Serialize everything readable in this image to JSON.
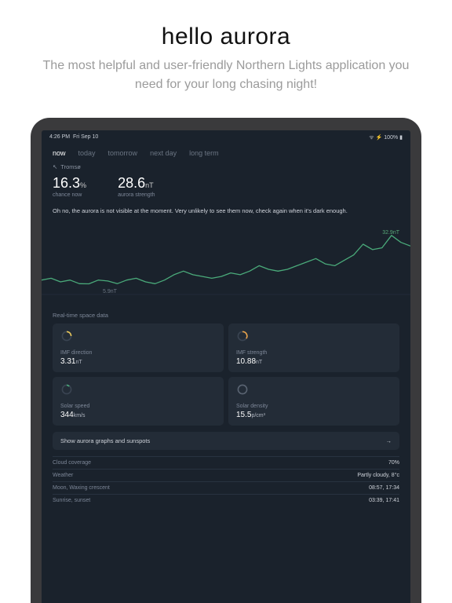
{
  "marketing": {
    "title": "hello aurora",
    "subtitle": "The most helpful and user-friendly Northern Lights application you need for your long chasing night!"
  },
  "statusbar": {
    "time": "4:26 PM",
    "date": "Fri Sep 10",
    "battery": "100%"
  },
  "tabs": [
    "now",
    "today",
    "tomorrow",
    "next day",
    "long term"
  ],
  "active_tab": "now",
  "location": "Tromsø",
  "metrics": {
    "chance": {
      "value": "16.3",
      "unit": "%",
      "label": "chance now"
    },
    "strength": {
      "value": "28.6",
      "unit": "nT",
      "label": "aurora strength"
    }
  },
  "message": "Oh no, the aurora is not visible at the moment. Very unlikely to see them now, check again when it's dark enough.",
  "chart_data": {
    "type": "line",
    "title": "",
    "x": [
      0,
      1,
      2,
      3,
      4,
      5,
      6,
      7,
      8,
      9,
      10,
      11,
      12,
      13,
      14,
      15,
      16,
      17,
      18,
      19,
      20,
      21,
      22,
      23,
      24,
      25,
      26,
      27,
      28,
      29,
      30,
      31,
      32,
      33,
      34,
      35,
      36,
      37,
      38,
      39
    ],
    "values": [
      8,
      9,
      7,
      8,
      6,
      5.9,
      8,
      7.5,
      6,
      8,
      9,
      7,
      6,
      8,
      11,
      13,
      11,
      10,
      9,
      10,
      12,
      11,
      13,
      16,
      14,
      13,
      14,
      16,
      18,
      20,
      17,
      16,
      19,
      22,
      28,
      25,
      26,
      32.9,
      29,
      27
    ],
    "ylim": [
      0,
      35
    ],
    "ylabel": "nT",
    "high_label": "32.9nT",
    "low_label": "5.9nT",
    "color": "#4aaa7a"
  },
  "section_title": "Real-time space data",
  "cards": [
    {
      "id": "imf-direction",
      "label": "IMF direction",
      "value": "3.31",
      "unit": "nT",
      "icon": "gauge-partial-yellow"
    },
    {
      "id": "imf-strength",
      "label": "IMF strength",
      "value": "10.88",
      "unit": "nT",
      "icon": "gauge-partial-orange"
    },
    {
      "id": "solar-speed",
      "label": "Solar speed",
      "value": "344",
      "unit": "km/s",
      "icon": "gauge-partial-green"
    },
    {
      "id": "solar-density",
      "label": "Solar density",
      "value": "15.5",
      "unit": "p/cm³",
      "icon": "gauge-full-grey"
    }
  ],
  "graph_button": "Show aurora graphs and sunspots",
  "meta_rows": [
    {
      "label": "Cloud coverage",
      "value": "70%"
    },
    {
      "label": "Weather",
      "value": "Partly cloudy, 8°c"
    },
    {
      "label": "Moon, Waxing crescent",
      "value": "08:57, 17:34"
    },
    {
      "label": "Sunrise, sunset",
      "value": "03:39, 17:41"
    }
  ],
  "colors": {
    "bg": "#1a222c",
    "card": "#232c37",
    "accent": "#4aaa7a"
  }
}
